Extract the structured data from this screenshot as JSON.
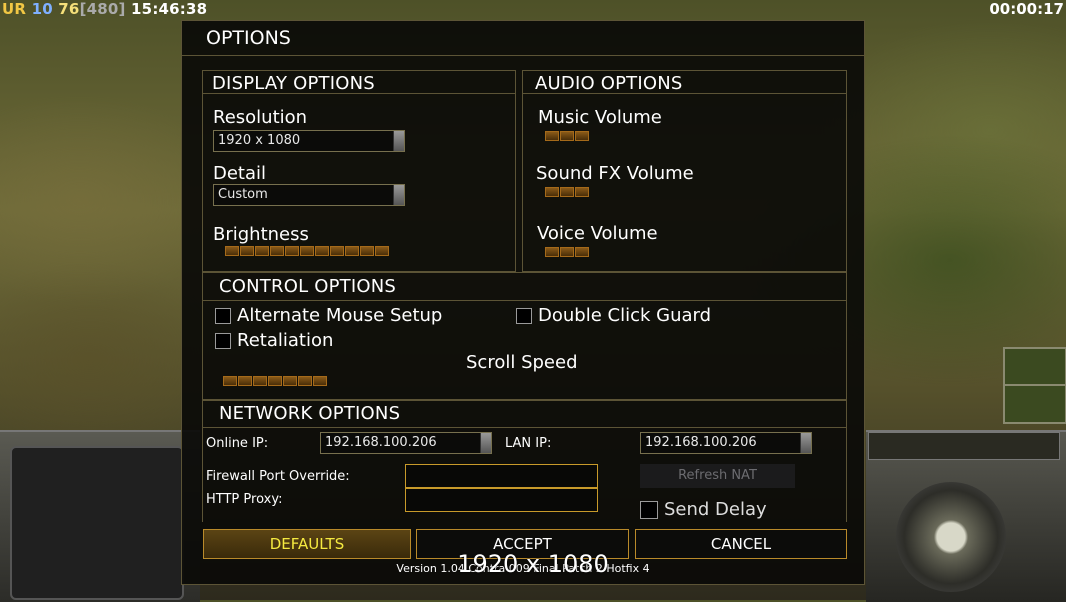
{
  "hud": {
    "ur": "UR",
    "a": "10",
    "b": "76",
    "c": "[480]",
    "time": "15:46:38",
    "elapsed": "00:00:17"
  },
  "dialog": {
    "title": "OPTIONS"
  },
  "display": {
    "title": "DISPLAY OPTIONS",
    "resolution_label": "Resolution",
    "resolution_value": "1920 x 1080",
    "detail_label": "Detail",
    "detail_value": "Custom",
    "brightness_label": "Brightness",
    "brightness_level": 11
  },
  "audio": {
    "title": "AUDIO OPTIONS",
    "music_label": "Music Volume",
    "music_level": 3,
    "sfx_label": "Sound FX Volume",
    "sfx_level": 3,
    "voice_label": "Voice Volume",
    "voice_level": 3
  },
  "control": {
    "title": "CONTROL OPTIONS",
    "alt_mouse_label": "Alternate Mouse Setup",
    "double_click_label": "Double Click Guard",
    "retaliation_label": "Retaliation",
    "scroll_speed_label": "Scroll Speed",
    "scroll_speed_level": 7
  },
  "network": {
    "title": "NETWORK OPTIONS",
    "online_ip_label": "Online IP:",
    "online_ip_value": "192.168.100.206",
    "lan_ip_label": "LAN IP:",
    "lan_ip_value": "192.168.100.206",
    "firewall_label": "Firewall Port Override:",
    "proxy_label": "HTTP Proxy:",
    "refresh_nat_label": "Refresh NAT",
    "send_delay_label": "Send Delay"
  },
  "buttons": {
    "defaults": "DEFAULTS",
    "accept": "ACCEPT",
    "cancel": "CANCEL"
  },
  "version": "Version 1.04 Contra 009 Final Patch 2 Hotfix 4",
  "overlay_resolution": "1920 x 1080",
  "colors": {
    "accent": "#b98a2a",
    "defaults_text": "#f5ea40",
    "panel_border": "#5c5436"
  }
}
